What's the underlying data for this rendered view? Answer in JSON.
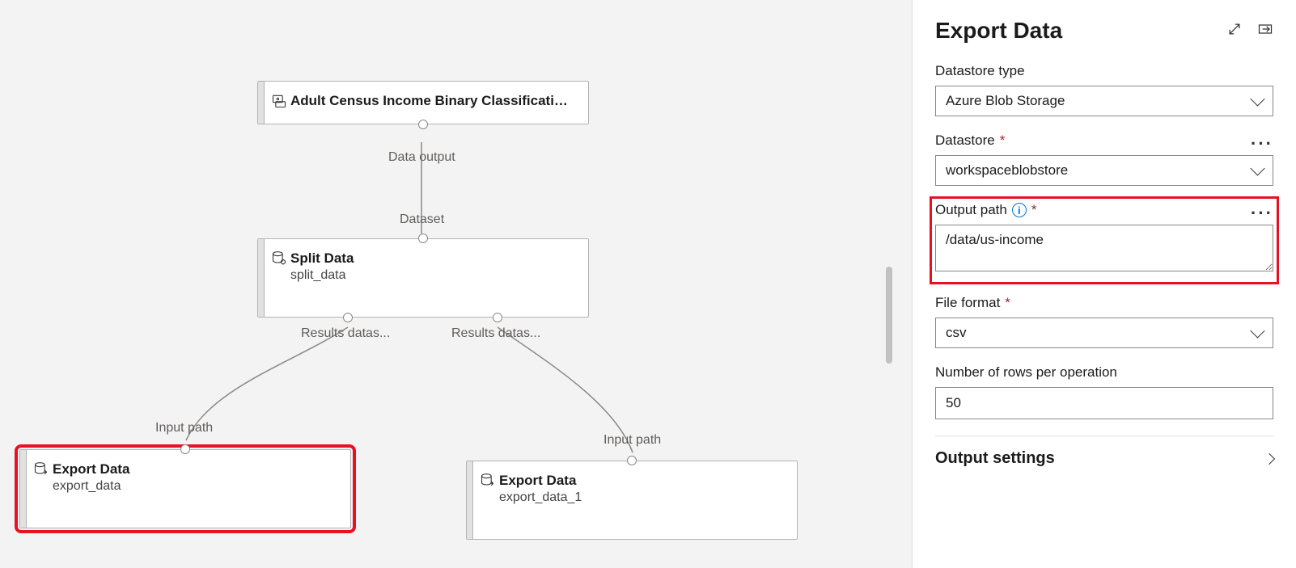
{
  "canvas": {
    "nodes": {
      "dataset": {
        "title": "Adult Census Income Binary Classificatio...",
        "out_label": "Data output"
      },
      "split": {
        "title": "Split Data",
        "subtitle": "split_data",
        "in_label": "Dataset",
        "out1_label": "Results datas...",
        "out2_label": "Results datas..."
      },
      "export1": {
        "title": "Export Data",
        "subtitle": "export_data",
        "in_label": "Input path"
      },
      "export2": {
        "title": "Export Data",
        "subtitle": "export_data_1",
        "in_label": "Input path"
      }
    }
  },
  "panel": {
    "title": "Export Data",
    "fields": {
      "datastore_type": {
        "label": "Datastore type",
        "value": "Azure Blob Storage"
      },
      "datastore": {
        "label": "Datastore",
        "value": "workspaceblobstore"
      },
      "output_path": {
        "label": "Output path",
        "value": "/data/us-income"
      },
      "file_format": {
        "label": "File format",
        "value": "csv"
      },
      "rows": {
        "label": "Number of rows per operation",
        "value": "50"
      }
    },
    "section": "Output settings"
  }
}
